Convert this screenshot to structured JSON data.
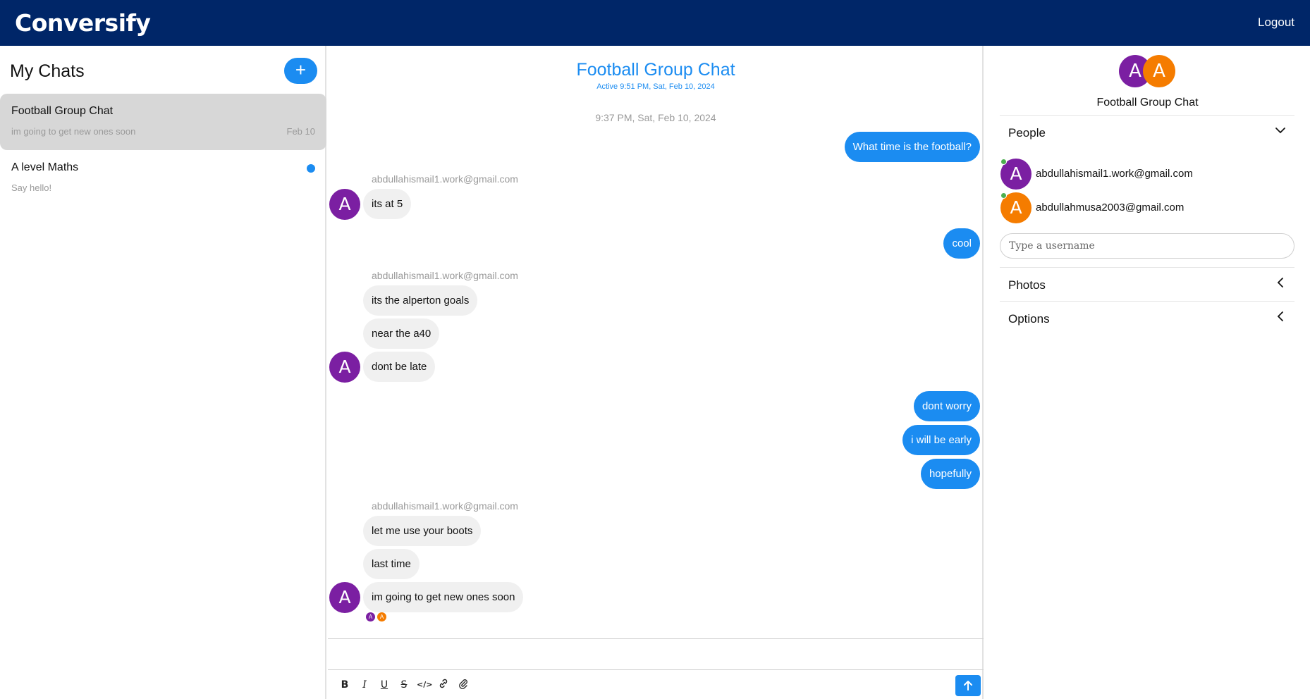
{
  "app": {
    "brand": "Conversify",
    "logout_label": "Logout"
  },
  "sidebar": {
    "title": "My Chats",
    "add_label": "+",
    "chats": [
      {
        "title": "Football Group Chat",
        "preview": "im going to get new ones soon",
        "date": "Feb 10",
        "active": true,
        "unread": false
      },
      {
        "title": "A level Maths",
        "preview": "Say hello!",
        "date": "",
        "active": false,
        "unread": true
      }
    ]
  },
  "chat": {
    "title": "Football Group Chat",
    "active_status": "Active 9:51 PM, Sat, Feb 10, 2024",
    "timestamp": "9:37 PM, Sat, Feb 10, 2024",
    "messages": [
      {
        "direction": "out",
        "text": "What time is the football?"
      },
      {
        "direction": "in",
        "sender": "abdullahismail1.work@gmail.com",
        "text": "its at 5"
      },
      {
        "direction": "out",
        "text": "cool"
      },
      {
        "direction": "in",
        "sender": "abdullahismail1.work@gmail.com",
        "text": "its the alperton goals"
      },
      {
        "direction": "in",
        "text": "near the a40"
      },
      {
        "direction": "in",
        "text": "dont be late"
      },
      {
        "direction": "out",
        "text": "dont worry"
      },
      {
        "direction": "out",
        "text": "i will be early"
      },
      {
        "direction": "out",
        "text": "hopefully"
      },
      {
        "direction": "in",
        "sender": "abdullahismail1.work@gmail.com",
        "text": "let me use your boots"
      },
      {
        "direction": "in",
        "text": "last time"
      },
      {
        "direction": "in",
        "text": "im going to get new ones soon"
      }
    ],
    "avatar_letter": "A",
    "read_receipts": [
      "A",
      "A"
    ],
    "composer": {
      "placeholder": "",
      "tools": [
        "bold-icon",
        "italic-icon",
        "underline-icon",
        "strikethrough-icon",
        "code-icon",
        "link-icon",
        "attachment-icon"
      ],
      "send_icon": "arrow-up-icon"
    }
  },
  "details": {
    "avatars": [
      "A",
      "A"
    ],
    "title": "Football Group Chat",
    "people_label": "People",
    "people": [
      {
        "letter": "A",
        "email": "abdullahismail1.work@gmail.com",
        "color": "#7b1fa2",
        "online": true
      },
      {
        "letter": "A",
        "email": "abdullahmusa2003@gmail.com",
        "color": "#f57c00",
        "online": true
      }
    ],
    "username_placeholder": "Type a username",
    "photos_label": "Photos",
    "options_label": "Options"
  },
  "colors": {
    "topbar": "#002668",
    "accent": "#1b8cf1",
    "purple": "#7b1fa2",
    "orange": "#f57c00",
    "online": "#4caf50"
  }
}
